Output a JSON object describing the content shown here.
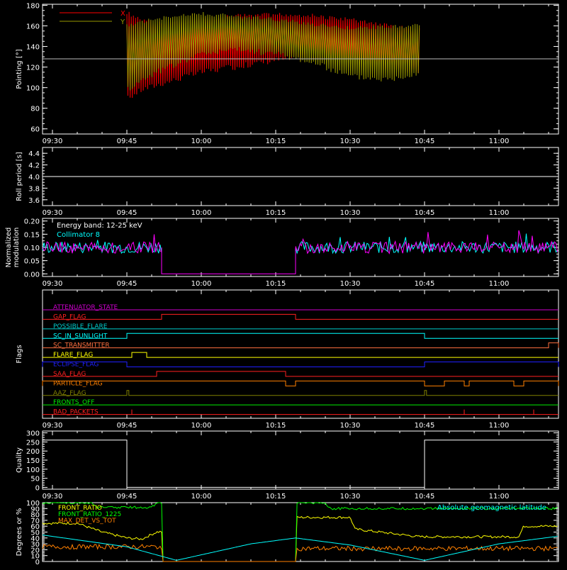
{
  "chart_data": [
    {
      "type": "line",
      "ylabel": "Pointing [°]",
      "ylim": [
        55,
        181
      ],
      "yticks": [
        60,
        80,
        100,
        120,
        140,
        160,
        180
      ],
      "xlim": [
        "09:28",
        "11:12"
      ],
      "xticks": [
        "09:30",
        "09:45",
        "10:00",
        "10:15",
        "10:30",
        "10:45",
        "11:00"
      ],
      "hline": 128,
      "legend": [
        {
          "label": "X",
          "color": "#ff0000"
        },
        {
          "label": "Y",
          "color": "#999900"
        }
      ],
      "series": [
        {
          "name": "X",
          "color": "#ff0000",
          "x": [
            "09:45",
            "09:48",
            "09:52",
            "10:00",
            "10:08",
            "10:15",
            "10:22",
            "10:30",
            "10:38",
            "10:44"
          ],
          "upper": [
            175,
            167,
            164,
            168,
            172,
            173,
            172,
            168,
            162,
            158
          ],
          "lower": [
            86,
            95,
            101,
            112,
            118,
            124,
            126,
            124,
            115,
            112
          ]
        },
        {
          "name": "Y",
          "color": "#999900",
          "x": [
            "09:45",
            "09:50",
            "10:00",
            "10:07",
            "10:15",
            "10:22",
            "10:30",
            "10:38",
            "10:44"
          ],
          "upper": [
            162,
            168,
            174,
            171,
            168,
            164,
            160,
            161,
            163
          ],
          "lower": [
            95,
            110,
            130,
            134,
            130,
            122,
            108,
            105,
            112
          ]
        }
      ]
    },
    {
      "type": "line",
      "ylabel": "Roll period [s]",
      "ylim": [
        3.5,
        4.5
      ],
      "yticks": [
        3.6,
        3.8,
        4.0,
        4.2,
        4.4
      ],
      "xlim": [
        "09:28",
        "11:12"
      ],
      "xticks": [
        "09:30",
        "09:45",
        "10:00",
        "10:15",
        "10:30",
        "10:45",
        "11:00"
      ],
      "series": [
        {
          "name": "",
          "color": "#ffffff",
          "x": [
            "09:28",
            "11:12"
          ],
          "y": [
            4.0,
            4.0
          ]
        }
      ]
    },
    {
      "type": "line",
      "ylabel": "Normalized modulation",
      "ylim": [
        -0.01,
        0.21
      ],
      "yticks": [
        0.0,
        0.05,
        0.1,
        0.15,
        0.2
      ],
      "xlim": [
        "09:28",
        "11:12"
      ],
      "xticks": [
        "09:30",
        "09:45",
        "10:00",
        "10:15",
        "10:30",
        "10:45",
        "11:00"
      ],
      "annotation": "Energy band: 12-25 keV",
      "series": [
        {
          "name": "Collimator 8",
          "color": "#00ffff",
          "segments": [
            [
              "09:28",
              "09:52"
            ],
            [
              "10:19",
              "11:12"
            ]
          ],
          "level": 0.1
        },
        {
          "name": "",
          "color": "#ff00ff",
          "segments": [
            [
              "09:28",
              "09:52"
            ],
            [
              "10:19",
              "11:12"
            ]
          ],
          "level": 0.1
        }
      ]
    },
    {
      "type": "line",
      "ylabel": "Flags",
      "xlim": [
        "09:28",
        "11:12"
      ],
      "xticks": [
        "09:30",
        "09:45",
        "10:00",
        "10:15",
        "10:30",
        "10:45",
        "11:00"
      ],
      "flags": [
        {
          "name": "ATTENUATOR_STATE",
          "color": "#cc00cc",
          "high": []
        },
        {
          "name": "GAP_FLAG",
          "color": "#ff2020",
          "high": [
            [
              "09:52",
              "10:19"
            ]
          ]
        },
        {
          "name": "POSSIBLE_FLARE",
          "color": "#00cccc",
          "high": []
        },
        {
          "name": "SC_IN_SUNLIGHT",
          "color": "#00ffff",
          "high": [
            [
              "09:45",
              "10:45"
            ]
          ]
        },
        {
          "name": "SC_TRANSMITTER",
          "color": "#ff7040",
          "high": [
            [
              "11:10",
              "11:12"
            ]
          ]
        },
        {
          "name": "FLARE_FLAG",
          "color": "#ffff00",
          "high": [
            [
              "09:46",
              "09:49"
            ]
          ]
        },
        {
          "name": "ECLIPSE_FLAG",
          "color": "#2020ff",
          "high": [
            [
              "09:28",
              "09:45"
            ],
            [
              "10:45",
              "11:12"
            ]
          ]
        },
        {
          "name": "SAA_FLAG",
          "color": "#ff2020",
          "high": [
            [
              "09:51",
              "10:17"
            ]
          ]
        },
        {
          "name": "PARTICLE_FLAG",
          "color": "#ff8000",
          "high": [
            [
              "09:28",
              "10:17"
            ],
            [
              "10:19",
              "10:45"
            ],
            [
              "10:49",
              "10:53"
            ],
            [
              "10:54",
              "11:03"
            ],
            [
              "11:05",
              "11:12"
            ]
          ]
        },
        {
          "name": "AAZ_FLAG",
          "color": "#808000",
          "high": [
            [
              "09:45",
              "09:45"
            ],
            [
              "10:45",
              "10:45"
            ]
          ]
        },
        {
          "name": "FRONTS_OFF",
          "color": "#00ee00",
          "high": []
        },
        {
          "name": "BAD_PACKETS",
          "color": "#ff2020",
          "spikes": [
            "09:46",
            "10:53",
            "11:07"
          ]
        }
      ]
    },
    {
      "type": "line",
      "ylabel": "Quality",
      "ylim": [
        -10,
        310
      ],
      "yticks": [
        0,
        50,
        100,
        150,
        200,
        250,
        300
      ],
      "xlim": [
        "09:28",
        "11:12"
      ],
      "xticks": [
        "09:30",
        "09:45",
        "10:00",
        "10:15",
        "10:30",
        "10:45",
        "11:00"
      ],
      "series": [
        {
          "name": "",
          "color": "#ffffff",
          "x": [
            "09:28",
            "09:45",
            "09:45",
            "10:45",
            "10:45",
            "11:12"
          ],
          "y": [
            260,
            260,
            0,
            0,
            260,
            260
          ]
        }
      ]
    },
    {
      "type": "line",
      "ylabel": "Degrees or %",
      "ylim": [
        0,
        100
      ],
      "yticks": [
        0,
        10,
        20,
        30,
        40,
        50,
        60,
        70,
        80,
        90,
        100
      ],
      "xlim": [
        "09:28",
        "11:12"
      ],
      "gaps": [
        [
          "09:52",
          "10:19"
        ]
      ],
      "series": [
        {
          "name": "FRONT_RATIO",
          "color": "#ffff00",
          "x": [
            "09:28",
            "09:35",
            "09:40",
            "09:45",
            "09:48",
            "09:51",
            "10:19",
            "10:30",
            "10:31",
            "10:44",
            "10:50",
            "11:04",
            "11:05",
            "11:12"
          ],
          "y": [
            65,
            65,
            50,
            40,
            38,
            50,
            75,
            75,
            55,
            42,
            42,
            42,
            60,
            60
          ]
        },
        {
          "name": "FRONT_RATIO_1225",
          "color": "#00ff00",
          "x": [
            "09:28",
            "09:38",
            "09:39",
            "09:50",
            "09:51",
            "10:19",
            "10:25",
            "10:26",
            "11:12"
          ],
          "y": [
            100,
            100,
            92,
            92,
            100,
            100,
            100,
            90,
            90
          ]
        },
        {
          "name": "MAX_DET_VS_TOT",
          "color": "#ff8000",
          "x": [
            "09:28",
            "09:51",
            "10:19",
            "11:12"
          ],
          "y": [
            25,
            25,
            22,
            22
          ]
        },
        {
          "name": "Absolute geomagnetic latitude",
          "color": "#00ffff",
          "x": [
            "09:28",
            "09:45",
            "09:55",
            "10:10",
            "10:19",
            "10:30",
            "10:45",
            "11:00",
            "11:12"
          ],
          "y": [
            45,
            25,
            2,
            30,
            40,
            28,
            2,
            30,
            43
          ]
        }
      ]
    }
  ]
}
